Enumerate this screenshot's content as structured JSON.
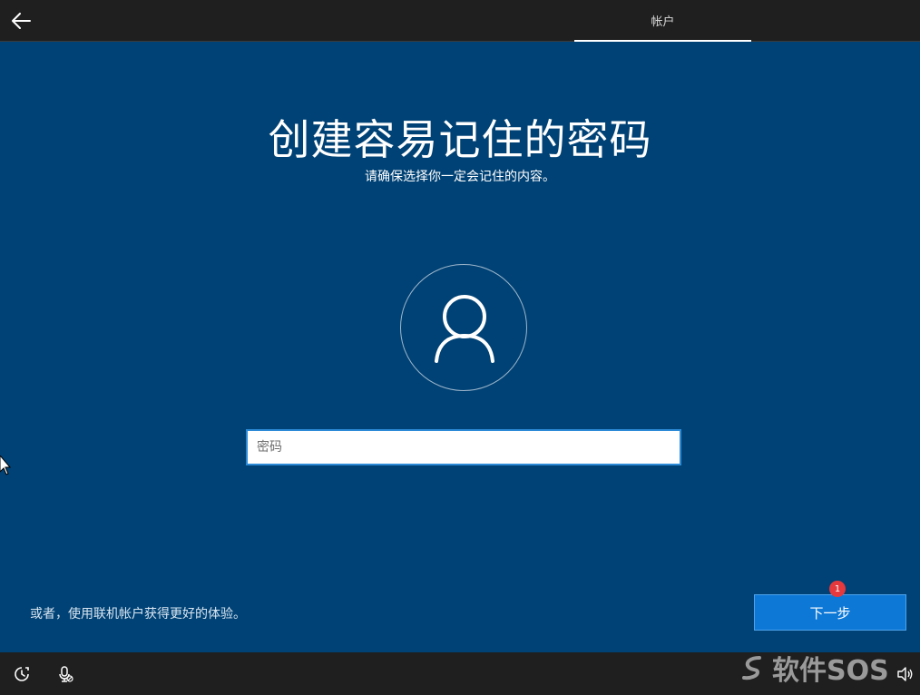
{
  "header": {
    "back_icon": "arrow-left-icon",
    "tab_label": "帐户"
  },
  "main": {
    "title": "创建容易记住的密码",
    "subtitle": "请确保选择你一定会记住的内容。",
    "avatar_icon": "user-icon",
    "password_input": {
      "placeholder": "密码",
      "value": ""
    },
    "online_account_link": "或者，使用联机帐户获得更好的体验。",
    "next_button": "下一步",
    "next_badge": "1"
  },
  "footer": {
    "icons": [
      "ease-of-access-icon",
      "microphone-off-icon",
      "volume-icon"
    ],
    "watermark_text": "软件SOS"
  },
  "colors": {
    "background": "#004275",
    "bar": "#1f1f1f",
    "accent": "#0e78d7",
    "badge": "#e5393d"
  }
}
